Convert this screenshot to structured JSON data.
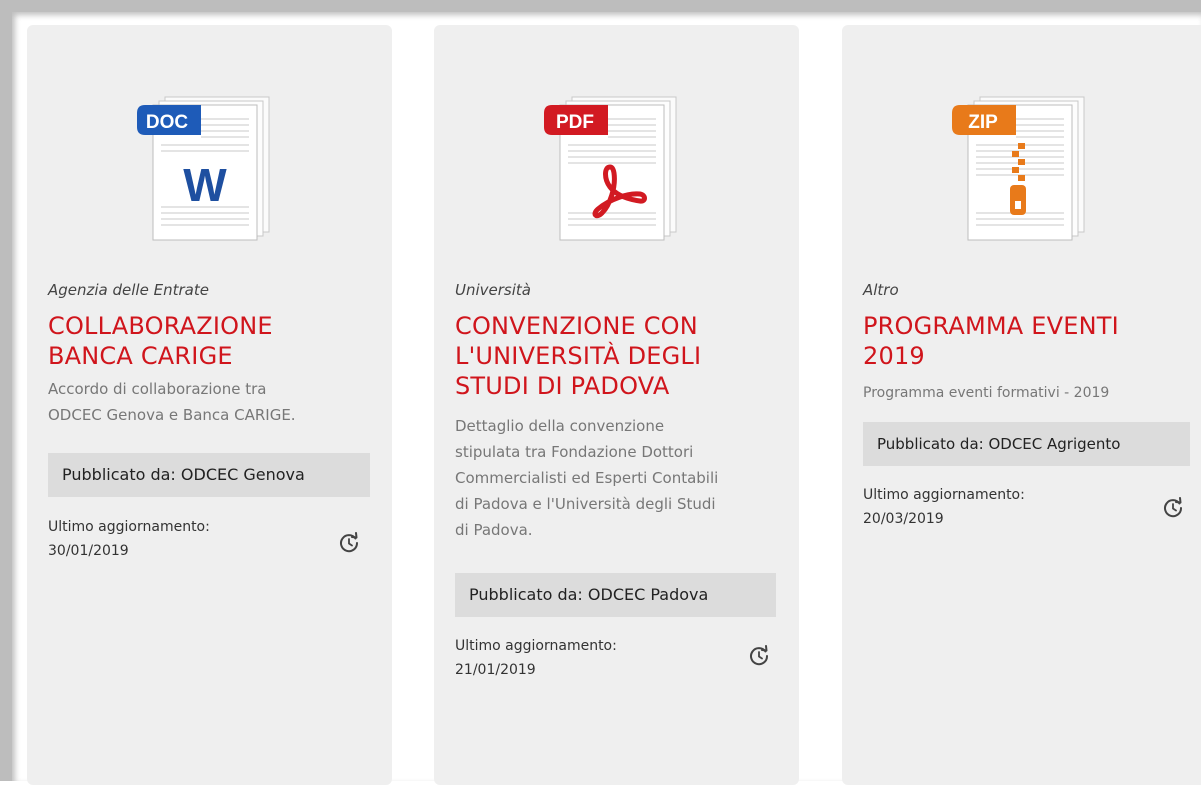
{
  "cards": [
    {
      "file_type": "DOC",
      "icon": "word-document-icon",
      "category": "Agenzia delle Entrate",
      "title_line1": "COLLABORAZIONE",
      "title_line2": "BANCA CARIGE",
      "desc_line1": "Accordo di collaborazione tra",
      "desc_line2": "ODCEC Genova e Banca CARIGE.",
      "publisher": "Pubblicato da: ODCEC Genova",
      "updated_label": "Ultimo aggiornamento:",
      "updated_date": "30/01/2019"
    },
    {
      "file_type": "PDF",
      "icon": "pdf-document-icon",
      "category": "Università",
      "title_line1": "CONVENZIONE CON",
      "title_line2": "L'UNIVERSITÀ DEGLI",
      "title_line3": "STUDI DI PADOVA",
      "desc_line1": "Dettaglio della convenzione",
      "desc_line2": "stipulata tra Fondazione Dottori",
      "desc_line3": "Commercialisti ed Esperti Contabili",
      "desc_line4": "di Padova e l'Università degli Studi",
      "desc_line5": "di Padova.",
      "publisher": "Pubblicato da: ODCEC Padova",
      "updated_label": "Ultimo aggiornamento:",
      "updated_date": "21/01/2019"
    },
    {
      "file_type": "ZIP",
      "icon": "zip-archive-icon",
      "category": "Altro",
      "title_line1": "PROGRAMMA EVENTI",
      "title_line2": "2019",
      "desc_line1": "Programma eventi formativi - 2019",
      "publisher": "Pubblicato da: ODCEC Agrigento",
      "updated_label": "Ultimo aggiornamento:",
      "updated_date": "20/03/2019"
    }
  ],
  "colors": {
    "title": "#d0151c",
    "doc_badge": "#1e5bb8",
    "pdf_badge": "#d21a22",
    "zip_badge": "#e87a1a"
  }
}
